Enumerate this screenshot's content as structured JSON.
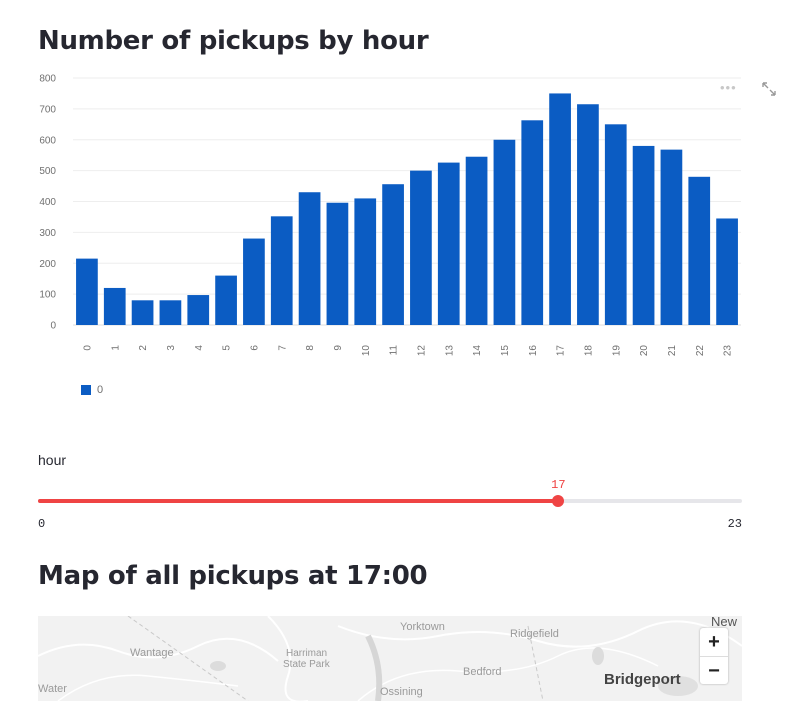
{
  "chart_section": {
    "title": "Number of pickups by hour"
  },
  "chart_data": {
    "type": "bar",
    "categories": [
      "0",
      "1",
      "2",
      "3",
      "4",
      "5",
      "6",
      "7",
      "8",
      "9",
      "10",
      "11",
      "12",
      "13",
      "14",
      "15",
      "16",
      "17",
      "18",
      "19",
      "20",
      "21",
      "22",
      "23"
    ],
    "series": [
      {
        "name": "0",
        "values": [
          215,
          120,
          80,
          80,
          97,
          160,
          280,
          352,
          430,
          396,
          410,
          456,
          500,
          526,
          545,
          600,
          663,
          750,
          715,
          650,
          580,
          568,
          480,
          345
        ]
      }
    ],
    "ylim": [
      0,
      800
    ],
    "yticks": [
      0,
      100,
      200,
      300,
      400,
      500,
      600,
      700,
      800
    ],
    "grid": true,
    "legend": "bottom-left",
    "bar_color": "#0b5cc3"
  },
  "slider": {
    "label": "hour",
    "value": "17",
    "min": "0",
    "max": "23",
    "value_num": 17,
    "min_num": 0,
    "max_num": 23,
    "color": "#ef4444"
  },
  "map_section": {
    "title": "Map of all pickups at 17:00",
    "labels": {
      "new": "New",
      "yorktown": "Yorktown",
      "ridgefield": "Ridgefield",
      "wantage": "Wantage",
      "harriman": "Harriman",
      "state_park": "State Park",
      "bedford": "Bedford",
      "bridgeport": "Bridgeport",
      "ossining": "Ossining",
      "water": "Water"
    },
    "zoom_in": "+",
    "zoom_out": "−"
  }
}
